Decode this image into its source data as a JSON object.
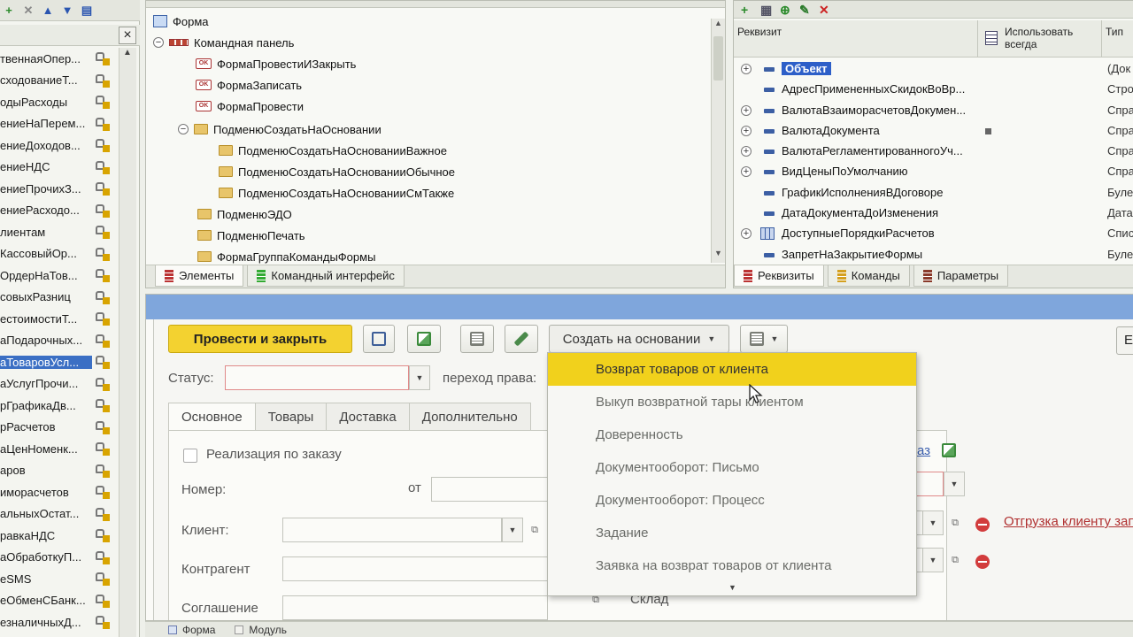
{
  "left_panel": {
    "close_label": "×",
    "items": [
      {
        "label": "твеннаяОпер..."
      },
      {
        "label": "сходованиеТ..."
      },
      {
        "label": "одыРасходы"
      },
      {
        "label": "ениеНаПерем..."
      },
      {
        "label": "ениеДоходов..."
      },
      {
        "label": "ениеНДС"
      },
      {
        "label": "ениеПрочихЗ..."
      },
      {
        "label": "ениеРасходо..."
      },
      {
        "label": "лиентам"
      },
      {
        "label": "КассовыйОр..."
      },
      {
        "label": "ОрдерНаТов..."
      },
      {
        "label": "совыхРазниц"
      },
      {
        "label": "естоимостиТ..."
      },
      {
        "label": "аПодарочных..."
      },
      {
        "label": "аТоваровУсл...",
        "selected": true
      },
      {
        "label": "аУслугПрочи..."
      },
      {
        "label": "рГрафикаДв..."
      },
      {
        "label": "рРасчетов"
      },
      {
        "label": "аЦенНоменк..."
      },
      {
        "label": "аров"
      },
      {
        "label": "иморасчетов"
      },
      {
        "label": "альныхОстат..."
      },
      {
        "label": "равкаНДС"
      },
      {
        "label": "аОбработкуП..."
      },
      {
        "label": "еSMS"
      },
      {
        "label": "еОбменСБанк..."
      },
      {
        "label": "езналичныхД..."
      }
    ]
  },
  "tree": {
    "nodes": [
      {
        "label": "Форма",
        "icon": "form-icon",
        "level": 0
      },
      {
        "label": "Командная панель",
        "icon": "command-panel-icon",
        "level": 0,
        "expander": "⊖"
      },
      {
        "label": "ФормаПровестиИЗакрыть",
        "icon": "ok-command-icon",
        "level": 1
      },
      {
        "label": "ФормаЗаписать",
        "icon": "ok-command-icon",
        "level": 1
      },
      {
        "label": "ФормаПровести",
        "icon": "ok-command-icon",
        "level": 1
      },
      {
        "label": "ПодменюСоздатьНаОсновании",
        "icon": "folder-icon",
        "level": 1,
        "expander": "⊖"
      },
      {
        "label": "ПодменюСоздатьНаОснованииВажное",
        "icon": "folder-icon",
        "level": 2
      },
      {
        "label": "ПодменюСоздатьНаОснованииОбычное",
        "icon": "folder-icon",
        "level": 2
      },
      {
        "label": "ПодменюСоздатьНаОснованииСмТакже",
        "icon": "folder-icon",
        "level": 2
      },
      {
        "label": "ПодменюЭДО",
        "icon": "folder-icon",
        "level": 1
      },
      {
        "label": "ПодменюПечать",
        "icon": "folder-icon",
        "level": 1
      },
      {
        "label": "ФормаГруппаКомандыФормы",
        "icon": "folder-icon",
        "level": 1
      }
    ],
    "tabs": [
      {
        "label": "Элементы",
        "icon": "red"
      },
      {
        "label": "Командный интерфейс",
        "icon": "green"
      }
    ]
  },
  "attributes": {
    "headers": {
      "name": "Реквизит",
      "always_use": "Использовать всегда",
      "type": "Тип"
    },
    "rows": [
      {
        "name": "Объект",
        "type": "(Док",
        "expander": true,
        "selected": true
      },
      {
        "name": "АдресПримененныхСкидокВоВр...",
        "type": "Стро"
      },
      {
        "name": "ВалютаВзаиморасчетовДокумен...",
        "type": "Спра",
        "expander": true
      },
      {
        "name": "ВалютаДокумента",
        "type": "Спра",
        "expander": true,
        "checked": true
      },
      {
        "name": "ВалютаРегламентированногоУч...",
        "type": "Спра",
        "expander": true
      },
      {
        "name": "ВидЦеныПоУмолчанию",
        "type": "Спра",
        "expander": true
      },
      {
        "name": "ГрафикИсполненияВДоговоре",
        "type": "Буле"
      },
      {
        "name": "ДатаДокументаДоИзменения",
        "type": "Дата"
      },
      {
        "name": "ДоступныеПорядкиРасчетов",
        "type": "Спис",
        "expander": true,
        "table": true
      },
      {
        "name": "ЗапретНаЗакрытиеФормы",
        "type": "Буле"
      }
    ],
    "tabs": [
      {
        "label": "Реквизиты",
        "icon": "red"
      },
      {
        "label": "Команды",
        "icon": "yellow"
      },
      {
        "label": "Параметры",
        "icon": "brown"
      }
    ]
  },
  "form": {
    "post_close_label": "Провести и закрыть",
    "create_based_label": "Создать на основании",
    "right_button_label": "Е",
    "status_label": "Статус:",
    "transition_label": "переход права:",
    "tabs": [
      "Основное",
      "Товары",
      "Доставка",
      "Дополнительно"
    ],
    "by_order_label": "Реализация по заказу",
    "number_label": "Номер:",
    "from_label": "от",
    "client_label": "Клиент:",
    "counterparty_label": "Контрагент",
    "agreement_label": "Соглашение",
    "warehouse_label": "Склад",
    "link_fragment": "аз",
    "shipment_link": "Отгрузка клиенту зап"
  },
  "dropdown": {
    "items": [
      {
        "label": "Возврат товаров от клиента",
        "highlighted": true
      },
      {
        "label": "Выкуп возвратной тары клиентом"
      },
      {
        "label": "Доверенность"
      },
      {
        "label": "Документооборот: Письмо"
      },
      {
        "label": "Документооборот: Процесс"
      },
      {
        "label": "Задание"
      },
      {
        "label": "Заявка на возврат товаров от клиента"
      }
    ]
  },
  "bottom_tabs": [
    {
      "label": "Форма"
    },
    {
      "label": "Модуль"
    }
  ],
  "colors": {
    "accent_yellow": "#f3d230",
    "selection_blue": "#2d5fc8",
    "preview_header": "#7fa6dc",
    "error_red": "#d23c3c"
  }
}
